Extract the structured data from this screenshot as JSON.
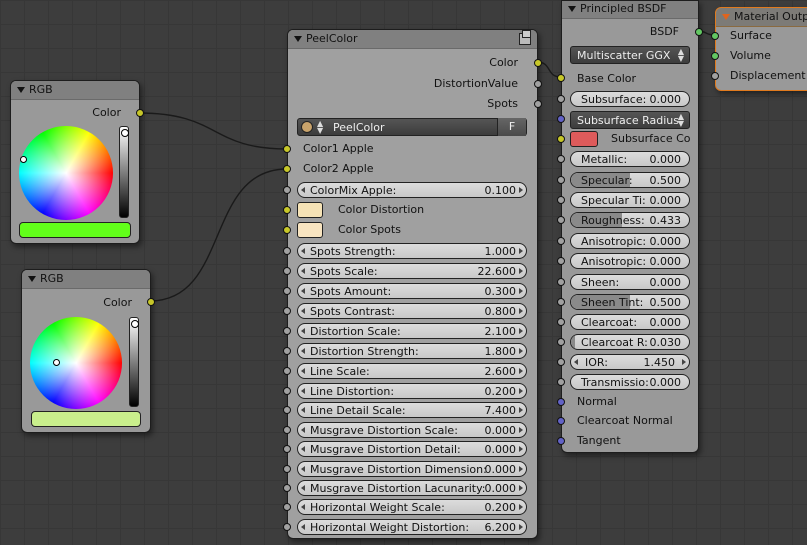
{
  "rgb_node_1": {
    "title": "RGB",
    "output": "Color",
    "color_value": "#62ff1a"
  },
  "rgb_node_2": {
    "title": "RGB",
    "output": "Color",
    "color_value": "#c9ef8c"
  },
  "peel_node": {
    "title": "PeelColor",
    "outputs": [
      "Color",
      "DistortionValue",
      "Spots"
    ],
    "nodetree_name": "PeelColor",
    "fake_user": "F",
    "inputs": {
      "color1": "Color1 Apple",
      "color2": "Color2 Apple"
    },
    "color_inputs": [
      {
        "label": "Color Distortion",
        "color": "#f6e3b6"
      },
      {
        "label": "Color Spots",
        "color": "#f8e4c0"
      }
    ],
    "fields": [
      {
        "label": "ColorMix Apple:",
        "value": "0.100"
      },
      {
        "label": "Spots Strength:",
        "value": "1.000"
      },
      {
        "label": "Spots Scale:",
        "value": "22.600"
      },
      {
        "label": "Spots Amount:",
        "value": "0.300"
      },
      {
        "label": "Spots Contrast:",
        "value": "0.800"
      },
      {
        "label": "Distortion Scale:",
        "value": "2.100"
      },
      {
        "label": "Distortion Strength:",
        "value": "1.800"
      },
      {
        "label": "Line Scale:",
        "value": "2.600"
      },
      {
        "label": "Line Distortion:",
        "value": "0.200"
      },
      {
        "label": "Line Detail Scale:",
        "value": "7.400"
      },
      {
        "label": "Musgrave Distortion Scale:",
        "value": "0.000"
      },
      {
        "label": "Musgrave Distortion Detail:",
        "value": "0.000"
      },
      {
        "label": "Musgrave Distortion Dimension:",
        "value": "0.000"
      },
      {
        "label": "Musgrave Distortion Lacunarity:",
        "value": "0.000"
      },
      {
        "label": "Horizontal Weight Scale:",
        "value": "0.200"
      },
      {
        "label": "Horizontal Weight Distortion:",
        "value": "6.200"
      }
    ]
  },
  "bsdf_node": {
    "title": "Principled BSDF",
    "output": "BSDF",
    "distribution": "Multiscatter GGX",
    "base_color": "Base Color",
    "subsurface_method": "Subsurface Radius",
    "subsurface_color_label": "Subsurface Co",
    "subsurface_color": "#de5b5b",
    "fields": [
      {
        "label": "Subsurface:",
        "value": "0.000",
        "fill": 0.0
      },
      {
        "label": "Metallic:",
        "value": "0.000",
        "fill": 0.0
      },
      {
        "label": "Specular:",
        "value": "0.500",
        "fill": 0.5
      },
      {
        "label": "Specular Ti:",
        "value": "0.000",
        "fill": 0.0
      },
      {
        "label": "Roughness:",
        "value": "0.433",
        "fill": 0.433
      },
      {
        "label": "Anisotropic:",
        "value": "0.000",
        "fill": 0.0
      },
      {
        "label": "Anisotropic:",
        "value": "0.000",
        "fill": 0.0
      },
      {
        "label": "Sheen:",
        "value": "0.000",
        "fill": 0.0
      },
      {
        "label": "Sheen Tint:",
        "value": "0.500",
        "fill": 0.5
      },
      {
        "label": "Clearcoat:",
        "value": "0.000",
        "fill": 0.0
      },
      {
        "label": "Clearcoat R:",
        "value": "0.030",
        "fill": 0.03
      },
      {
        "label": "IOR:",
        "value": "1.450",
        "fill": null
      },
      {
        "label": "Transmissio:",
        "value": "0.000",
        "fill": 0.0
      }
    ],
    "vector_inputs": [
      "Normal",
      "Clearcoat Normal",
      "Tangent"
    ]
  },
  "output_node": {
    "title": "Material Output",
    "inputs": [
      "Surface",
      "Volume",
      "Displacement"
    ]
  }
}
